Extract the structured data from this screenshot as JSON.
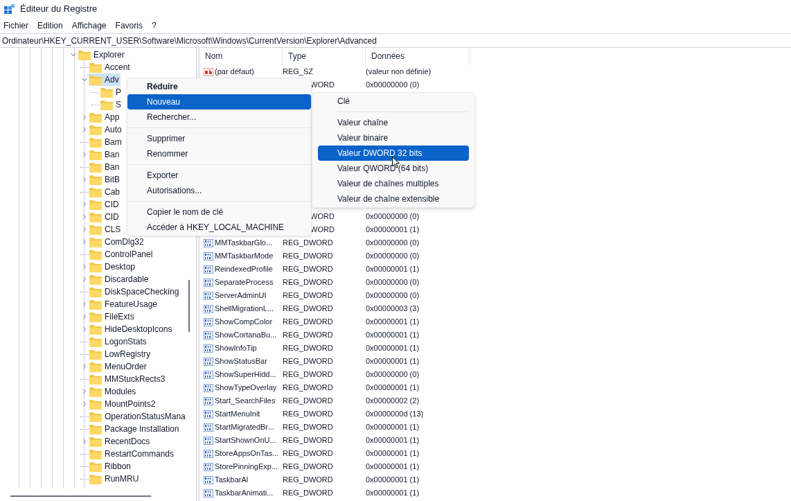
{
  "window": {
    "title": "Éditeur du Registre"
  },
  "menu_bar": [
    "Fichier",
    "Edition",
    "Affichage",
    "Favoris",
    "?"
  ],
  "address": "Ordinateur\\HKEY_CURRENT_USER\\Software\\Microsoft\\Windows\\CurrentVersion\\Explorer\\Advanced",
  "tree": [
    {
      "label": "Explorer",
      "kind": "expanded",
      "selected": false,
      "children": [
        {
          "label": "Accent",
          "kind": "leaf",
          "selected": false
        },
        {
          "label": "Adv",
          "kind": "expanded",
          "selected": true,
          "children": [
            {
              "label": "P",
              "kind": "leaf",
              "selected": false
            },
            {
              "label": "S",
              "kind": "leaf",
              "selected": false
            }
          ]
        },
        {
          "label": "App",
          "kind": "collapsed",
          "selected": false
        },
        {
          "label": "Auto",
          "kind": "collapsed",
          "selected": false
        },
        {
          "label": "Bam",
          "kind": "leaf",
          "selected": false
        },
        {
          "label": "Ban",
          "kind": "collapsed",
          "selected": false
        },
        {
          "label": "Ban",
          "kind": "leaf",
          "selected": false
        },
        {
          "label": "BitB",
          "kind": "collapsed",
          "selected": false
        },
        {
          "label": "Cab",
          "kind": "leaf",
          "selected": false
        },
        {
          "label": "CID",
          "kind": "collapsed",
          "selected": false
        },
        {
          "label": "CID",
          "kind": "collapsed",
          "selected": false
        },
        {
          "label": "CLS",
          "kind": "collapsed",
          "selected": false
        },
        {
          "label": "ComDlg32",
          "kind": "collapsed",
          "selected": false
        },
        {
          "label": "ControlPanel",
          "kind": "leaf",
          "selected": false
        },
        {
          "label": "Desktop",
          "kind": "collapsed",
          "selected": false
        },
        {
          "label": "Discardable",
          "kind": "collapsed",
          "selected": false
        },
        {
          "label": "DiskSpaceChecking",
          "kind": "leaf",
          "selected": false
        },
        {
          "label": "FeatureUsage",
          "kind": "collapsed",
          "selected": false
        },
        {
          "label": "FileExts",
          "kind": "collapsed",
          "selected": false
        },
        {
          "label": "HideDesktopIcons",
          "kind": "collapsed",
          "selected": false
        },
        {
          "label": "LogonStats",
          "kind": "leaf",
          "selected": false
        },
        {
          "label": "LowRegistry",
          "kind": "leaf",
          "selected": false
        },
        {
          "label": "MenuOrder",
          "kind": "collapsed",
          "selected": false
        },
        {
          "label": "MMStuckRects3",
          "kind": "leaf",
          "selected": false
        },
        {
          "label": "Modules",
          "kind": "collapsed",
          "selected": false
        },
        {
          "label": "MountPoints2",
          "kind": "collapsed",
          "selected": false
        },
        {
          "label": "OperationStatusMana",
          "kind": "leaf",
          "selected": false
        },
        {
          "label": "Package Installation",
          "kind": "leaf",
          "selected": false
        },
        {
          "label": "RecentDocs",
          "kind": "collapsed",
          "selected": false
        },
        {
          "label": "RestartCommands",
          "kind": "leaf",
          "selected": false
        },
        {
          "label": "Ribbon",
          "kind": "leaf",
          "selected": false
        },
        {
          "label": "RunMRU",
          "kind": "leaf",
          "selected": false
        }
      ]
    }
  ],
  "columns": [
    "Nom",
    "Type",
    "Données"
  ],
  "rows_top": [
    {
      "kind": "string",
      "name": "(par défaut)",
      "type": "REG_SZ",
      "data": "(valeur non définie)"
    },
    {
      "kind": "covered",
      "type": "WORD",
      "data": "0x00000000 (0)"
    }
  ],
  "rows": [
    {
      "kind": "covered",
      "type": "WORD",
      "data": "0x00000000 (0)"
    },
    {
      "kind": "covered",
      "type": "WORD",
      "data": "0x00000001 (1)"
    },
    {
      "kind": "dword",
      "name": "MMTaskbarGlo...",
      "type": "REG_DWORD",
      "data": "0x00000000 (0)"
    },
    {
      "kind": "dword",
      "name": "MMTaskbarMode",
      "type": "REG_DWORD",
      "data": "0x00000000 (0)"
    },
    {
      "kind": "dword",
      "name": "ReindexedProfile",
      "type": "REG_DWORD",
      "data": "0x00000001 (1)"
    },
    {
      "kind": "dword",
      "name": "SeparateProcess",
      "type": "REG_DWORD",
      "data": "0x00000000 (0)"
    },
    {
      "kind": "dword",
      "name": "ServerAdminUI",
      "type": "REG_DWORD",
      "data": "0x00000000 (0)"
    },
    {
      "kind": "dword",
      "name": "ShellMigrationL...",
      "type": "REG_DWORD",
      "data": "0x00000003 (3)"
    },
    {
      "kind": "dword",
      "name": "ShowCompColor",
      "type": "REG_DWORD",
      "data": "0x00000001 (1)"
    },
    {
      "kind": "dword",
      "name": "ShowCortanaBu...",
      "type": "REG_DWORD",
      "data": "0x00000001 (1)"
    },
    {
      "kind": "dword",
      "name": "ShowInfoTip",
      "type": "REG_DWORD",
      "data": "0x00000001 (1)"
    },
    {
      "kind": "dword",
      "name": "ShowStatusBar",
      "type": "REG_DWORD",
      "data": "0x00000001 (1)"
    },
    {
      "kind": "dword",
      "name": "ShowSuperHidd...",
      "type": "REG_DWORD",
      "data": "0x00000000 (0)"
    },
    {
      "kind": "dword",
      "name": "ShowTypeOverlay",
      "type": "REG_DWORD",
      "data": "0x00000001 (1)"
    },
    {
      "kind": "dword",
      "name": "Start_SearchFiles",
      "type": "REG_DWORD",
      "data": "0x00000002 (2)"
    },
    {
      "kind": "dword",
      "name": "StartMenuInit",
      "type": "REG_DWORD",
      "data": "0x0000000d (13)"
    },
    {
      "kind": "dword",
      "name": "StartMigratedBr...",
      "type": "REG_DWORD",
      "data": "0x00000001 (1)"
    },
    {
      "kind": "dword",
      "name": "StartShownOnU...",
      "type": "REG_DWORD",
      "data": "0x00000001 (1)"
    },
    {
      "kind": "dword",
      "name": "StoreAppsOnTas...",
      "type": "REG_DWORD",
      "data": "0x00000001 (1)"
    },
    {
      "kind": "dword",
      "name": "StorePinningExp...",
      "type": "REG_DWORD",
      "data": "0x00000001 (1)"
    },
    {
      "kind": "dword",
      "name": "TaskbarAl",
      "type": "REG_DWORD",
      "data": "0x00000001 (1)"
    },
    {
      "kind": "dword",
      "name": "TaskbarAnimati...",
      "type": "REG_DWORD",
      "data": "0x00000001 (1)"
    }
  ],
  "context_menu": [
    {
      "label": "Réduire",
      "kind": "default",
      "selected": false,
      "separator_before": false
    },
    {
      "label": "Nouveau",
      "kind": "normal",
      "selected": true,
      "separator_before": false
    },
    {
      "label": "Rechercher...",
      "kind": "normal",
      "selected": false,
      "separator_before": false
    },
    {
      "label": "Supprimer",
      "kind": "normal",
      "selected": false,
      "separator_before": true
    },
    {
      "label": "Renommer",
      "kind": "normal",
      "selected": false,
      "separator_before": false
    },
    {
      "label": "Exporter",
      "kind": "normal",
      "selected": false,
      "separator_before": true
    },
    {
      "label": "Autorisations...",
      "kind": "normal",
      "selected": false,
      "separator_before": false
    },
    {
      "label": "Copier le nom de clé",
      "kind": "normal",
      "selected": false,
      "separator_before": true
    },
    {
      "label": "Accéder à HKEY_LOCAL_MACHINE",
      "kind": "normal",
      "selected": false,
      "separator_before": false
    }
  ],
  "submenu": [
    {
      "label": "Clé",
      "selected": false,
      "separator_before": false
    },
    {
      "label": "Valeur chaîne",
      "selected": false,
      "separator_before": true
    },
    {
      "label": "Valeur binaire",
      "selected": false,
      "separator_before": false
    },
    {
      "label": "Valeur DWORD 32 bits",
      "selected": true,
      "separator_before": false
    },
    {
      "label": "Valeur QWORD (64 bits)",
      "selected": false,
      "separator_before": false
    },
    {
      "label": "Valeur de chaînes multiples",
      "selected": false,
      "separator_before": false
    },
    {
      "label": "Valeur de chaîne extensible",
      "selected": false,
      "separator_before": false
    }
  ]
}
